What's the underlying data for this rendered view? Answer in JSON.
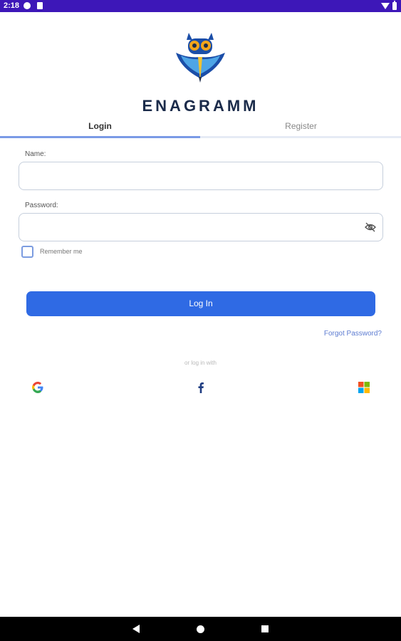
{
  "status_bar": {
    "time": "2:18"
  },
  "brand": {
    "name": "ENAGRAMM"
  },
  "tabs": [
    {
      "label": "Login"
    },
    {
      "label": "Register"
    }
  ],
  "form": {
    "name_label": "Name:",
    "name_value": "",
    "password_label": "Password:",
    "password_value": "",
    "remember_label": "Remember me",
    "remember_checked": false
  },
  "actions": {
    "login_label": "Log In",
    "forgot_label": "Forgot Password?",
    "or_text": "or log in with"
  },
  "social": [
    {
      "icon": "google-icon"
    },
    {
      "icon": "facebook-icon"
    },
    {
      "icon": "microsoft-icon"
    }
  ],
  "nav": {
    "icons": [
      "back-icon",
      "home-icon",
      "recents-icon"
    ]
  },
  "colors": {
    "status_bar": "#3d17b8",
    "primary": "#2f6ae4",
    "tab_indicator": "#7a9ae6",
    "brand_text": "#1b2b4a",
    "link": "#5d7cd1"
  }
}
